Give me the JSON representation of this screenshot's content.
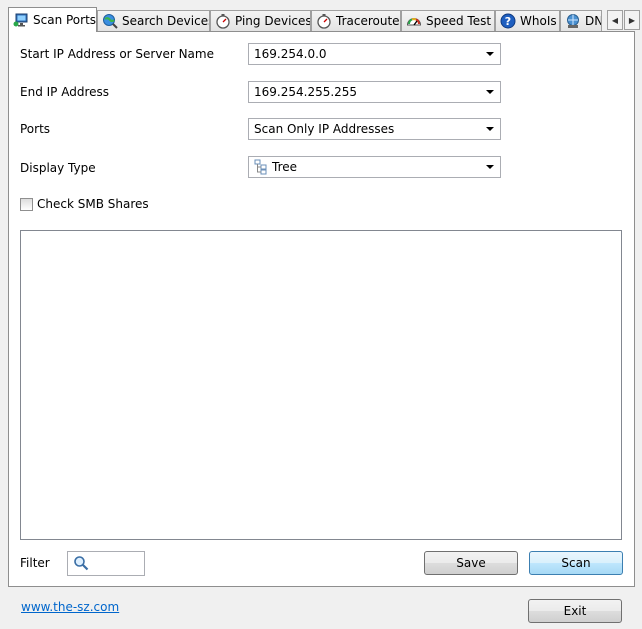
{
  "tabs": [
    {
      "label": "Scan Ports",
      "icon": "monitor-network-icon",
      "active": true
    },
    {
      "label": "Search Devices",
      "icon": "globe-search-icon",
      "active": false
    },
    {
      "label": "Ping Devices",
      "icon": "stopwatch-icon",
      "active": false
    },
    {
      "label": "Traceroute",
      "icon": "stopwatch-icon",
      "active": false
    },
    {
      "label": "Speed Test",
      "icon": "speedometer-icon",
      "active": false
    },
    {
      "label": "WhoIs",
      "icon": "help-icon",
      "active": false
    },
    {
      "label": "DN",
      "icon": "dns-icon",
      "active": false
    }
  ],
  "form": {
    "start_ip_label": "Start IP Address or Server Name",
    "start_ip_value": "169.254.0.0",
    "end_ip_label": "End IP Address",
    "end_ip_value": "169.254.255.255",
    "ports_label": "Ports",
    "ports_value": "Scan Only IP Addresses",
    "display_type_label": "Display Type",
    "display_type_value": "Tree",
    "smb_label": "Check SMB Shares",
    "smb_checked": false
  },
  "bottom": {
    "filter_label": "Filter",
    "save_label": "Save",
    "scan_label": "Scan"
  },
  "footer": {
    "link_text": "www.the-sz.com",
    "exit_label": "Exit"
  },
  "colors": {
    "link": "#0066cc",
    "default_button": "#3c7fb1"
  }
}
